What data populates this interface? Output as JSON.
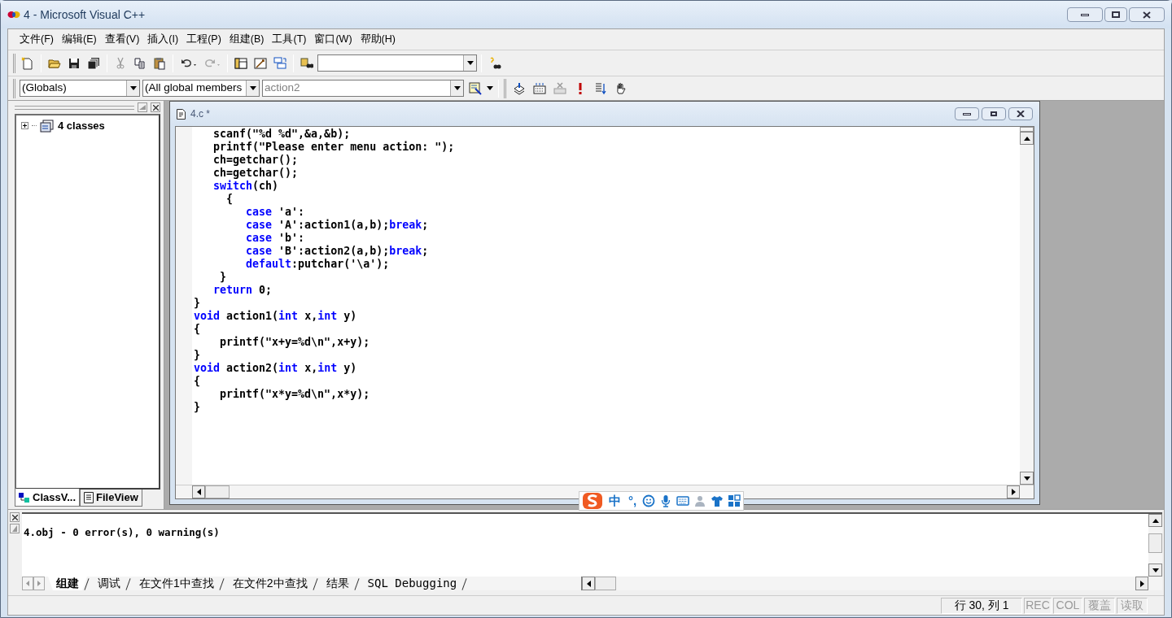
{
  "window": {
    "title": "4 - Microsoft Visual C++"
  },
  "menu": [
    "文件(F)",
    "编辑(E)",
    "查看(V)",
    "插入(I)",
    "工程(P)",
    "组建(B)",
    "工具(T)",
    "窗口(W)",
    "帮助(H)"
  ],
  "wizard_bar": [
    {
      "value": "(Globals)",
      "disabled": false
    },
    {
      "value": "(All global members",
      "disabled": false
    },
    {
      "value": "action2",
      "disabled": true
    }
  ],
  "workspace": {
    "tree": [
      {
        "label": "4 classes",
        "expanded": false
      }
    ],
    "tabs": [
      {
        "label": "ClassV...",
        "selected": true
      },
      {
        "label": "FileView",
        "selected": false
      }
    ]
  },
  "editor": {
    "title": "4.c *",
    "lines": [
      [
        {
          "kind": "text",
          "text": "   scanf(\"%d %d\",&a,&b);"
        }
      ],
      [
        {
          "kind": "text",
          "text": "   printf(\"Please enter menu action: \");"
        }
      ],
      [
        {
          "kind": "text",
          "text": "   ch=getchar();"
        }
      ],
      [
        {
          "kind": "text",
          "text": "   ch=getchar();"
        }
      ],
      [
        {
          "kind": "keyword",
          "text": "   switch"
        },
        {
          "kind": "text",
          "text": "(ch)"
        }
      ],
      [
        {
          "kind": "text",
          "text": "     {"
        }
      ],
      [
        {
          "kind": "keyword",
          "text": "        case"
        },
        {
          "kind": "text",
          "text": " 'a':"
        }
      ],
      [
        {
          "kind": "keyword",
          "text": "        case"
        },
        {
          "kind": "text",
          "text": " 'A':action1(a,b);"
        },
        {
          "kind": "keyword",
          "text": "break"
        },
        {
          "kind": "text",
          "text": ";"
        }
      ],
      [
        {
          "kind": "keyword",
          "text": "        case"
        },
        {
          "kind": "text",
          "text": " 'b':"
        }
      ],
      [
        {
          "kind": "keyword",
          "text": "        case"
        },
        {
          "kind": "text",
          "text": " 'B':action2(a,b);"
        },
        {
          "kind": "keyword",
          "text": "break"
        },
        {
          "kind": "text",
          "text": ";"
        }
      ],
      [
        {
          "kind": "keyword",
          "text": "        default"
        },
        {
          "kind": "text",
          "text": ":putchar('\\a');"
        }
      ],
      [
        {
          "kind": "text",
          "text": "    }"
        }
      ],
      [
        {
          "kind": "keyword",
          "text": "   return"
        },
        {
          "kind": "text",
          "text": " 0;"
        }
      ],
      [
        {
          "kind": "text",
          "text": "}"
        }
      ],
      [
        {
          "kind": "keyword",
          "text": "void"
        },
        {
          "kind": "text",
          "text": " action1("
        },
        {
          "kind": "keyword",
          "text": "int"
        },
        {
          "kind": "text",
          "text": " x,"
        },
        {
          "kind": "keyword",
          "text": "int"
        },
        {
          "kind": "text",
          "text": " y)"
        }
      ],
      [
        {
          "kind": "text",
          "text": "{"
        }
      ],
      [
        {
          "kind": "text",
          "text": "    printf(\"x+y=%d\\n\",x+y);"
        }
      ],
      [
        {
          "kind": "text",
          "text": "}"
        }
      ],
      [
        {
          "kind": "keyword",
          "text": "void"
        },
        {
          "kind": "text",
          "text": " action2("
        },
        {
          "kind": "keyword",
          "text": "int"
        },
        {
          "kind": "text",
          "text": " x,"
        },
        {
          "kind": "keyword",
          "text": "int"
        },
        {
          "kind": "text",
          "text": " y)"
        }
      ],
      [
        {
          "kind": "text",
          "text": "{"
        }
      ],
      [
        {
          "kind": "text",
          "text": "    printf(\"x*y=%d\\n\",x*y);"
        }
      ],
      [
        {
          "kind": "text",
          "text": "}"
        }
      ]
    ]
  },
  "ime_bar": [
    "中",
    "°,"
  ],
  "output": {
    "lines": [
      "4.obj - 0 error(s), 0 warning(s)"
    ],
    "tabs": [
      {
        "label": "组建",
        "selected": true
      },
      {
        "label": "调试",
        "selected": false
      },
      {
        "label": "在文件1中查找",
        "selected": false
      },
      {
        "label": "在文件2中查找",
        "selected": false
      },
      {
        "label": "结果",
        "selected": false
      },
      {
        "label": "SQL Debugging",
        "selected": false
      }
    ]
  },
  "status_bar": [
    {
      "text": "行 30, 列 1",
      "disabled": false
    },
    {
      "text": "REC",
      "disabled": true
    },
    {
      "text": "COL",
      "disabled": true
    },
    {
      "text": "覆盖",
      "disabled": true
    },
    {
      "text": "读取",
      "disabled": true
    }
  ]
}
